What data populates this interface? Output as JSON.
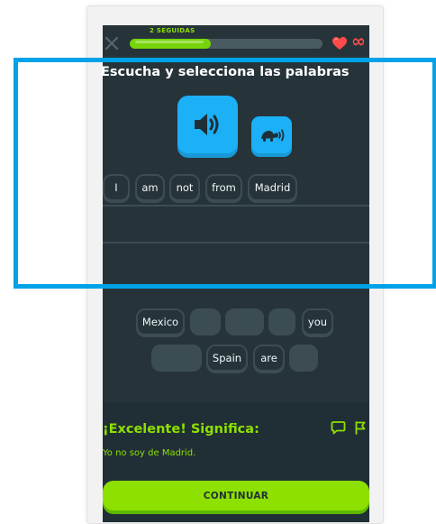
{
  "header": {
    "streak_label": "2 SEGUIDAS",
    "progress_fraction": 0.42,
    "hearts_count": "∞"
  },
  "exercise": {
    "instruction": "Escucha y selecciona las palabras",
    "answer_tiles": [
      "I",
      "am",
      "not",
      "from",
      "Madrid"
    ],
    "word_bank": {
      "row1": [
        "Mexico",
        "",
        "",
        "",
        "you"
      ],
      "row2": [
        "",
        "Spain",
        "are",
        ""
      ]
    }
  },
  "feedback": {
    "title": "¡Excelente! Significa:",
    "translation": "Yo no soy de Madrid."
  },
  "footer": {
    "continue_label": "CONTINUAR"
  },
  "colors": {
    "background": "#26343a",
    "accent_green": "#8ee000",
    "accent_blue": "#1cb0f6",
    "heart_red": "#ff4b4b",
    "highlight_blue": "#00a2e8"
  },
  "icons": [
    "close-icon",
    "heart-icon",
    "speaker-icon",
    "turtle-icon",
    "comment-icon",
    "flag-icon"
  ]
}
